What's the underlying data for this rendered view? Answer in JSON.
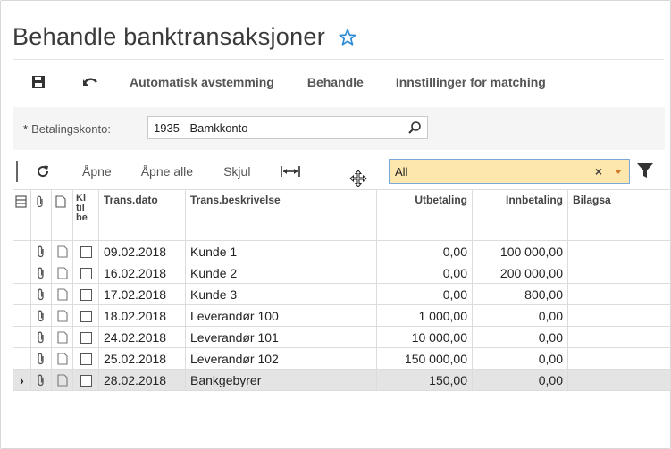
{
  "page": {
    "title": "Behandle banktransaksjoner"
  },
  "toolbar": {
    "save_icon": "save-icon",
    "undo_icon": "undo-icon",
    "auto_reconcile": "Automatisk avstemming",
    "process": "Behandle",
    "matching_settings": "Innstillinger for matching"
  },
  "form": {
    "required_marker": "*",
    "account_label": "Betalingskonto:",
    "account_value": "1935 - Bamkkonto"
  },
  "grid_toolbar": {
    "refresh_icon": "refresh-icon",
    "open": "Åpne",
    "open_all": "Åpne alle",
    "hide": "Skjul",
    "fit_icon": "fit-columns-icon",
    "filter_value": "All",
    "filter_clear": "×",
    "funnel_icon": "filter-funnel-icon"
  },
  "grid": {
    "columns": {
      "kl": [
        "Kl",
        "til",
        "be"
      ],
      "date": "Trans.dato",
      "desc": "Trans.beskrivelse",
      "out": "Utbetaling",
      "in": "Innbetaling",
      "ref": "Bilagsa"
    },
    "rows": [
      {
        "date": "09.02.2018",
        "desc": "Kunde 1",
        "out": "0,00",
        "in": "100 000,00",
        "selected": false
      },
      {
        "date": "16.02.2018",
        "desc": "Kunde 2",
        "out": "0,00",
        "in": "200 000,00",
        "selected": false
      },
      {
        "date": "17.02.2018",
        "desc": "Kunde 3",
        "out": "0,00",
        "in": "800,00",
        "selected": false
      },
      {
        "date": "18.02.2018",
        "desc": "Leverandør 100",
        "out": "1 000,00",
        "in": "0,00",
        "selected": false
      },
      {
        "date": "24.02.2018",
        "desc": "Leverandør 101",
        "out": "10 000,00",
        "in": "0,00",
        "selected": false
      },
      {
        "date": "25.02.2018",
        "desc": "Leverandør 102",
        "out": "150 000,00",
        "in": "0,00",
        "selected": false
      },
      {
        "date": "28.02.2018",
        "desc": "Bankgebyrer",
        "out": "150,00",
        "in": "0,00",
        "selected": true
      }
    ],
    "row_indicator": "›"
  },
  "colors": {
    "star": "#2a8ad4",
    "filter_bg": "#fde7ad",
    "filter_border": "#7aa8d8",
    "selected_row": "#e4e4e4"
  }
}
